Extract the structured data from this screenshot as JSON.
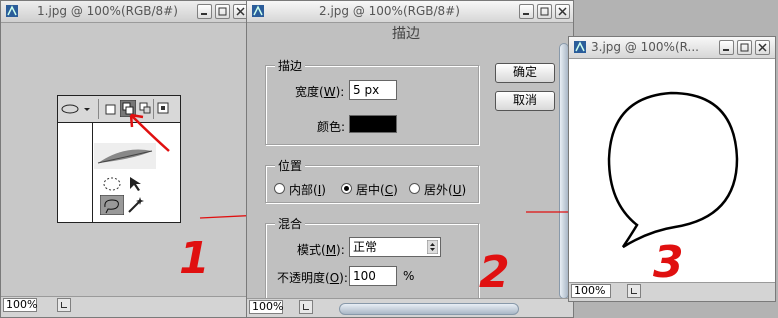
{
  "windows": {
    "w1": {
      "title": "1.jpg @ 100%(RGB/8#)",
      "zoom": "100%"
    },
    "w2": {
      "title": "2.jpg @ 100%(RGB/8#)",
      "zoom": "100%"
    },
    "w3": {
      "title": "3.jpg @ 100%(R...",
      "zoom": "100%"
    }
  },
  "dialog": {
    "heading": "描边",
    "stroke_group": "描边",
    "width_label_pre": "宽度(",
    "width_key": "W",
    "width_label_post": "):",
    "width_value": "5 px",
    "color_label": "颜色:",
    "color_value": "#000000",
    "location_group": "位置",
    "loc_inside_pre": "内部(",
    "loc_inside_key": "I",
    "loc_inside_post": ")",
    "loc_center_pre": "居中(",
    "loc_center_key": "C",
    "loc_center_post": ")",
    "loc_outside_pre": "居外(",
    "loc_outside_key": "U",
    "loc_outside_post": ")",
    "blend_group": "混合",
    "mode_label_pre": "模式(",
    "mode_key": "M",
    "mode_label_post": "):",
    "mode_value": "正常",
    "opacity_label_pre": "不透明度(",
    "opacity_key": "O",
    "opacity_label_post": "):",
    "opacity_value": "100",
    "opacity_unit": "%",
    "ok_label": "确定",
    "cancel_label": "取消"
  },
  "annotations": {
    "n1": "1",
    "n2": "2",
    "n3": "3"
  },
  "colors": {
    "annotation": "#e01010",
    "stroke_color": "#000000"
  }
}
